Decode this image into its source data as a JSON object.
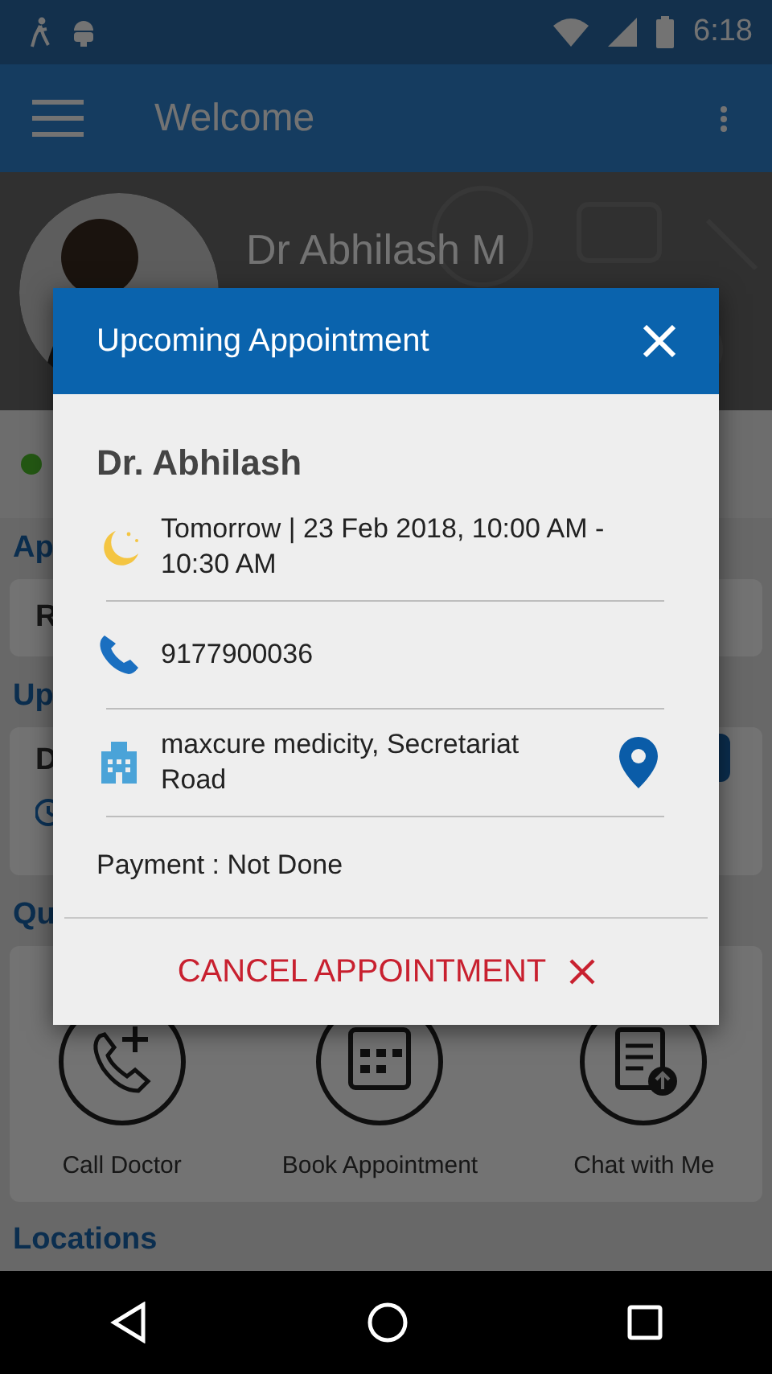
{
  "status_bar": {
    "time": "6:18"
  },
  "app_bar": {
    "title": "Welcome"
  },
  "profile": {
    "name": "Dr Abhilash M"
  },
  "appointments_section": {
    "heading": "Ap",
    "card_text": "R"
  },
  "upcoming_section": {
    "heading": "Up",
    "card_text": "D"
  },
  "quick_section": {
    "heading": "Qu",
    "actions": [
      {
        "kind": "call",
        "label": "Call Doctor"
      },
      {
        "kind": "book",
        "label": "Book Appointment"
      },
      {
        "kind": "chat",
        "label": "Chat with Me"
      }
    ]
  },
  "locations_heading": "Locations",
  "dialog": {
    "title": "Upcoming Appointment",
    "doctor": "Dr. Abhilash",
    "details": [
      {
        "kind": "time",
        "text": "Tomorrow | 23 Feb 2018, 10:00 AM - 10:30 AM",
        "map_pin": false
      },
      {
        "kind": "phone",
        "text": "9177900036",
        "map_pin": false
      },
      {
        "kind": "address",
        "text": "maxcure medicity, Secretariat Road",
        "map_pin": true
      }
    ],
    "payment": "Payment : Not Done",
    "cancel": "CANCEL APPOINTMENT"
  }
}
